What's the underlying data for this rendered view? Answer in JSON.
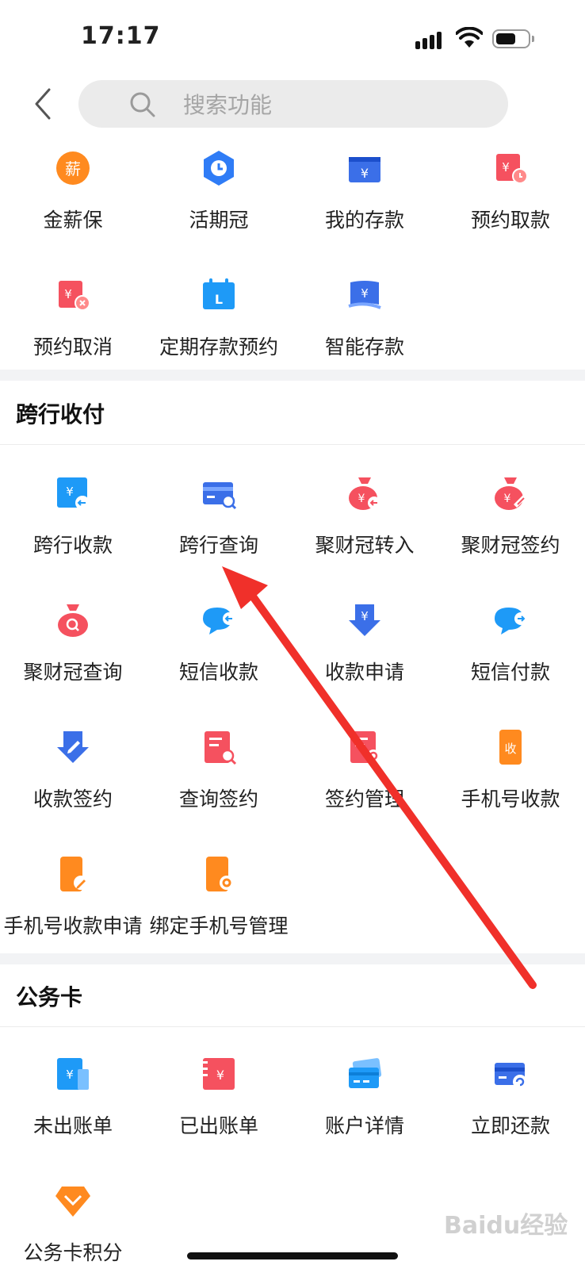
{
  "status": {
    "time": "17:17"
  },
  "search": {
    "placeholder": "搜索功能"
  },
  "deposit": {
    "items": [
      {
        "label": "金薪保",
        "icon": "salary-icon",
        "glyph": "薪"
      },
      {
        "label": "活期冠",
        "icon": "clock-icon"
      },
      {
        "label": "我的存款",
        "icon": "deposit-card-icon",
        "glyph": "¥"
      },
      {
        "label": "预约取款",
        "icon": "withdraw-appointment-icon",
        "glyph": "¥"
      },
      {
        "label": "预约取消",
        "icon": "cancel-appointment-icon",
        "glyph": "¥"
      },
      {
        "label": "定期存款预约",
        "icon": "calendar-icon",
        "glyph": "L"
      },
      {
        "label": "智能存款",
        "icon": "smart-deposit-icon",
        "glyph": "¥"
      }
    ]
  },
  "crossbank": {
    "title": "跨行收付",
    "items": [
      {
        "label": "跨行收款",
        "icon": "receive-icon",
        "glyph": "¥"
      },
      {
        "label": "跨行查询",
        "icon": "card-search-icon"
      },
      {
        "label": "聚财冠转入",
        "icon": "moneybag-in-icon",
        "glyph": "¥"
      },
      {
        "label": "聚财冠签约",
        "icon": "moneybag-sign-icon",
        "glyph": "¥"
      },
      {
        "label": "聚财冠查询",
        "icon": "moneybag-search-icon"
      },
      {
        "label": "短信收款",
        "icon": "sms-receive-icon"
      },
      {
        "label": "收款申请",
        "icon": "receive-request-icon",
        "glyph": "¥"
      },
      {
        "label": "短信付款",
        "icon": "sms-pay-icon"
      },
      {
        "label": "收款签约",
        "icon": "receive-sign-icon"
      },
      {
        "label": "查询签约",
        "icon": "doc-search-icon"
      },
      {
        "label": "签约管理",
        "icon": "sign-manage-icon"
      },
      {
        "label": "手机号收款",
        "icon": "phone-receive-icon",
        "glyph": "收"
      },
      {
        "label": "手机号收款申请",
        "icon": "phone-edit-icon"
      },
      {
        "label": "绑定手机号管理",
        "icon": "phone-settings-icon"
      }
    ]
  },
  "officialcard": {
    "title": "公务卡",
    "items": [
      {
        "label": "未出账单",
        "icon": "unbilled-icon",
        "glyph": "¥"
      },
      {
        "label": "已出账单",
        "icon": "billed-icon",
        "glyph": "¥"
      },
      {
        "label": "账户详情",
        "icon": "account-card-icon"
      },
      {
        "label": "立即还款",
        "icon": "repay-icon"
      },
      {
        "label": "公务卡积分",
        "icon": "points-icon"
      }
    ]
  },
  "watermark": "Baidu经验",
  "colors": {
    "blue": "#2f7cf6",
    "red": "#f5515f",
    "orange": "#ff8a1f",
    "arrow": "#f0302a"
  }
}
